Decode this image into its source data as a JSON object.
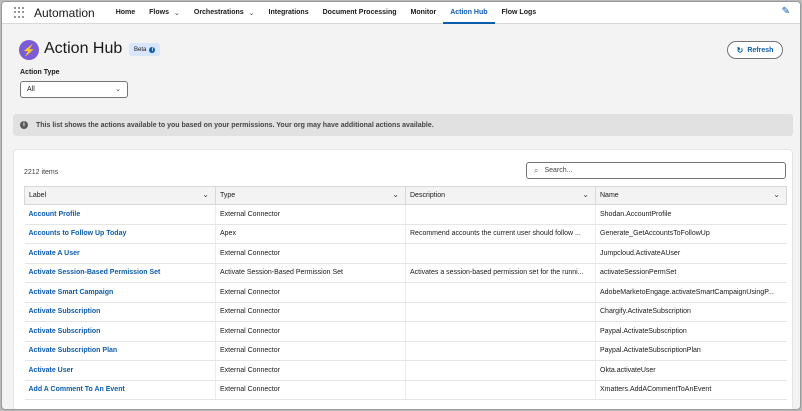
{
  "nav": {
    "app_name": "Automation",
    "items": [
      {
        "label": "Home",
        "dropdown": false,
        "active": false
      },
      {
        "label": "Flows",
        "dropdown": true,
        "active": false
      },
      {
        "label": "Orchestrations",
        "dropdown": true,
        "active": false
      },
      {
        "label": "Integrations",
        "dropdown": false,
        "active": false
      },
      {
        "label": "Document Processing",
        "dropdown": false,
        "active": false
      },
      {
        "label": "Monitor",
        "dropdown": false,
        "active": false
      },
      {
        "label": "Action Hub",
        "dropdown": false,
        "active": true
      },
      {
        "label": "Flow Logs",
        "dropdown": false,
        "active": false
      }
    ]
  },
  "header": {
    "title": "Action Hub",
    "badge": "Beta",
    "refresh_label": "Refresh"
  },
  "filter": {
    "label": "Action Type",
    "value": "All"
  },
  "banner": {
    "text": "This list shows the actions available to you based on your permissions. Your org may have additional actions available."
  },
  "list": {
    "count": "2212 items",
    "search_placeholder": "Search...",
    "columns": [
      "Label",
      "Type",
      "Description",
      "Name"
    ],
    "rows": [
      {
        "label": "Account Profile",
        "type": "External Connector",
        "description": "",
        "name": "Shodan.AccountProfile"
      },
      {
        "label": "Accounts to Follow Up Today",
        "type": "Apex",
        "description": "Recommend accounts the current user should follow ...",
        "name": "Generate_GetAccountsToFollowUp"
      },
      {
        "label": "Activate A User",
        "type": "External Connector",
        "description": "",
        "name": "Jumpcloud.ActivateAUser"
      },
      {
        "label": "Activate Session-Based Permission Set",
        "type": "Activate Session-Based Permission Set",
        "description": "Activates a session-based permission set for the runni...",
        "name": "activateSessionPermSet"
      },
      {
        "label": "Activate Smart Campaign",
        "type": "External Connector",
        "description": "",
        "name": "AdobeMarketoEngage.activateSmartCampaignUsingP..."
      },
      {
        "label": "Activate Subscription",
        "type": "External Connector",
        "description": "",
        "name": "Chargify.ActivateSubscription"
      },
      {
        "label": "Activate Subscription",
        "type": "External Connector",
        "description": "",
        "name": "Paypal.ActivateSubscription"
      },
      {
        "label": "Activate Subscription Plan",
        "type": "External Connector",
        "description": "",
        "name": "Paypal.ActivateSubscriptionPlan"
      },
      {
        "label": "Activate User",
        "type": "External Connector",
        "description": "",
        "name": "Okta.activateUser"
      },
      {
        "label": "Add A Comment To An Event",
        "type": "External Connector",
        "description": "",
        "name": "Xmatters.AddACommentToAnEvent"
      }
    ]
  },
  "colors": {
    "accent": "#0b5cab",
    "header_icon": "#7b5bd6",
    "badge_bg": "#d8e6fe"
  }
}
